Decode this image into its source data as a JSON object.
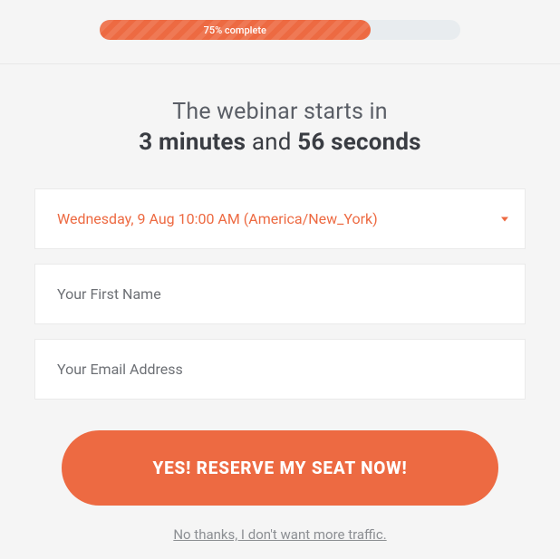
{
  "progress": {
    "label": "75% complete",
    "percent": 75
  },
  "heading": {
    "line1": "The webinar starts in",
    "minutes_value": "3 minutes",
    "and": " and ",
    "seconds_value": "56 seconds"
  },
  "form": {
    "session_select": {
      "selected": "Wednesday, 9 Aug 10:00 AM (America/New_York)"
    },
    "first_name": {
      "placeholder": "Your First Name",
      "value": ""
    },
    "email": {
      "placeholder": "Your Email Address",
      "value": ""
    }
  },
  "cta": {
    "reserve_label": "YES! RESERVE MY SEAT NOW!",
    "no_thanks_label": "No thanks, I don't want more traffic."
  }
}
